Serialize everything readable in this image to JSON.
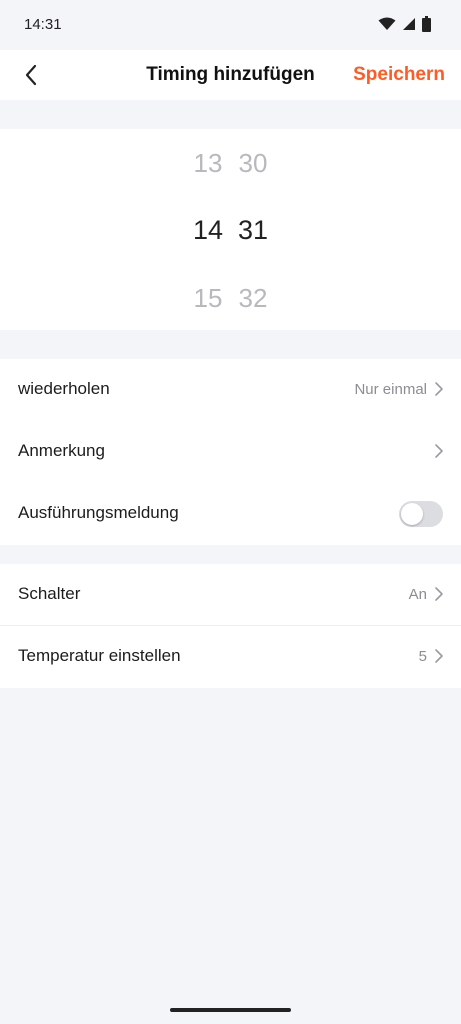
{
  "status_bar": {
    "time": "14:31",
    "icons": [
      "wifi-icon",
      "signal-icon",
      "battery-icon"
    ]
  },
  "header": {
    "back_icon": "chevron-left-icon",
    "title": "Timing hinzufügen",
    "save_label": "Speichern",
    "accent_color": "#ff5c25"
  },
  "time_picker": {
    "rows": [
      {
        "hour": "13",
        "minute": "30"
      },
      {
        "hour": "14",
        "minute": "31"
      },
      {
        "hour": "15",
        "minute": "32"
      }
    ],
    "selected_hour": "14",
    "selected_minute": "31"
  },
  "settings": {
    "repeat": {
      "label": "wiederholen",
      "value": "Nur einmal"
    },
    "note": {
      "label": "Anmerkung"
    },
    "notification": {
      "label": "Ausführungsmeldung",
      "enabled": false
    }
  },
  "actions": {
    "switch": {
      "label": "Schalter",
      "value": "An"
    },
    "temperature": {
      "label": "Temperatur einstellen",
      "value": "5"
    }
  }
}
